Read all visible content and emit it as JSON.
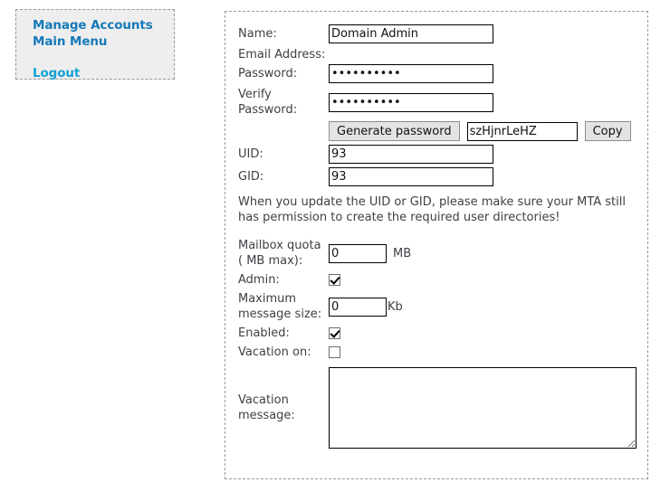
{
  "sidebar": {
    "links": [
      {
        "label": "Manage Accounts",
        "name": "manage-accounts"
      },
      {
        "label": "Main Menu",
        "name": "main-menu"
      },
      {
        "label": "Logout",
        "name": "logout"
      }
    ]
  },
  "form": {
    "name": {
      "label": "Name:",
      "value": "Domain Admin"
    },
    "email": {
      "label": "Email Address:",
      "value": ""
    },
    "password": {
      "label": "Password:",
      "value": "1234567890"
    },
    "verify_password": {
      "label": "Verify Password:",
      "value": "1234567890"
    },
    "generate_password_button": "Generate password",
    "generated_password": "szHjnrLeHZ",
    "copy_button": "Copy",
    "uid": {
      "label": "UID:",
      "value": "93"
    },
    "gid": {
      "label": "GID:",
      "value": "93"
    },
    "note": "When you update the UID or GID, please make sure your MTA still has permission to create the required user directories!",
    "mailbox_quota": {
      "label": "Mailbox quota ( MB max):",
      "value": "0",
      "unit": "MB"
    },
    "admin": {
      "label": "Admin:",
      "checked": true
    },
    "max_message_size": {
      "label": "Maximum message size:",
      "value": "0",
      "unit": "Kb"
    },
    "enabled": {
      "label": "Enabled:",
      "checked": true
    },
    "vacation_on": {
      "label": "Vacation on:",
      "checked": false
    },
    "vacation_message": {
      "label": "Vacation message:",
      "value": ""
    }
  },
  "colors": {
    "link_primary": "#1579b8",
    "link_logout": "#11a2d4",
    "panel_border": "#9a9a9a",
    "sidebar_bg": "#eeeeee",
    "label_text": "#3f3f46"
  }
}
